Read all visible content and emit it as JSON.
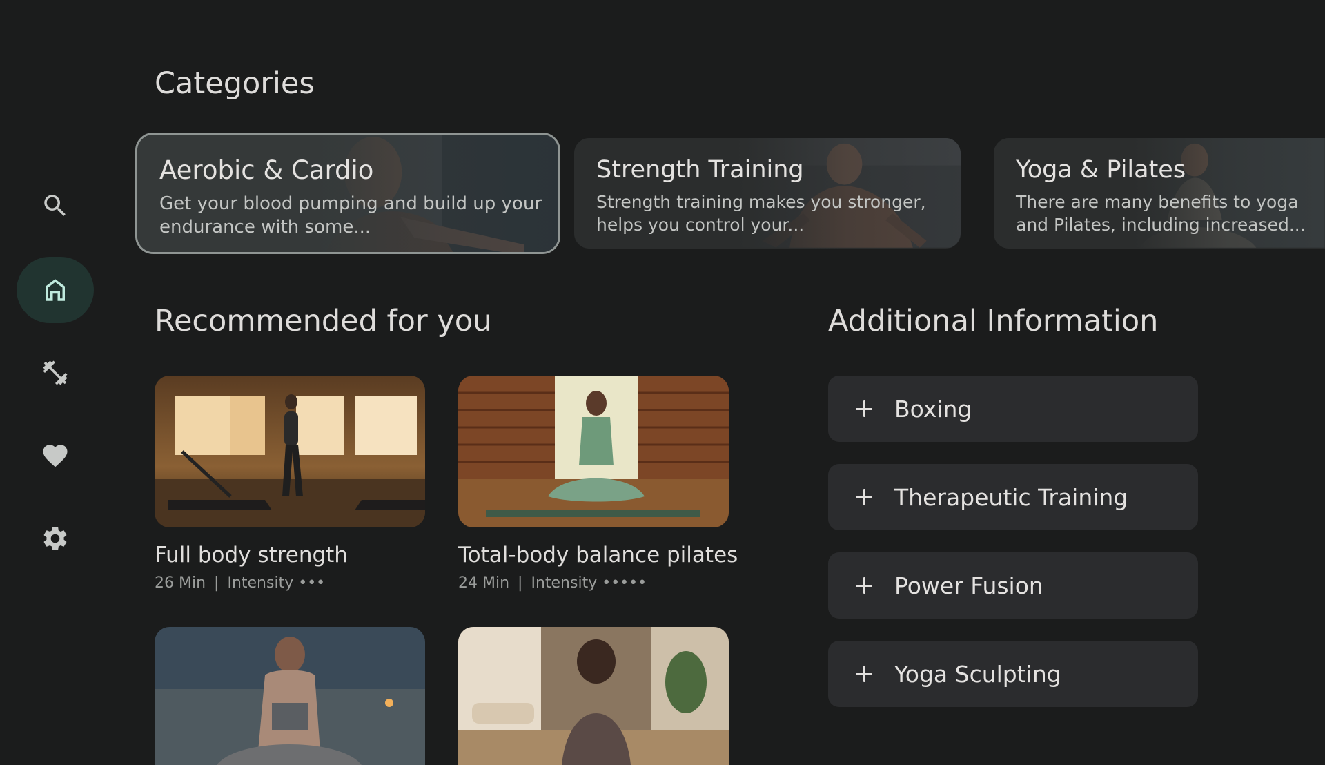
{
  "nav": {
    "items": [
      {
        "icon": "search-icon",
        "active": false
      },
      {
        "icon": "home-icon",
        "active": true
      },
      {
        "icon": "dumbbell-icon",
        "active": false
      },
      {
        "icon": "heart-icon",
        "active": false
      },
      {
        "icon": "gear-icon",
        "active": false
      }
    ]
  },
  "categories": {
    "title": "Categories",
    "items": [
      {
        "name": "Aerobic & Cardio",
        "description": "Get your blood pumping and build up your endurance with some...",
        "focused": true
      },
      {
        "name": "Strength Training",
        "description": "Strength training makes you stronger, helps you control your...",
        "focused": false
      },
      {
        "name": "Yoga & Pilates",
        "description": "There are many benefits to yoga and Pilates, including increased...",
        "focused": false
      }
    ]
  },
  "recommended": {
    "title": "Recommended for you",
    "items": [
      {
        "title": "Full body strength",
        "duration": "26 Min",
        "intensity_label": "Intensity",
        "intensity_dots": "•••"
      },
      {
        "title": "Total-body balance pilates",
        "duration": "24 Min",
        "intensity_label": "Intensity",
        "intensity_dots": "•••••"
      },
      {
        "title": "",
        "duration": "",
        "intensity_label": "",
        "intensity_dots": ""
      },
      {
        "title": "",
        "duration": "",
        "intensity_label": "",
        "intensity_dots": ""
      }
    ]
  },
  "additional": {
    "title": "Additional Information",
    "items": [
      {
        "label": "Boxing",
        "icon": "plus-icon"
      },
      {
        "label": "Therapeutic Training",
        "icon": "plus-icon"
      },
      {
        "label": "Power Fusion",
        "icon": "plus-icon"
      },
      {
        "label": "Yoga Sculpting",
        "icon": "plus-icon"
      }
    ]
  },
  "colors": {
    "background": "#1b1c1c",
    "nav_active_bg": "#213430",
    "nav_active_fg": "#bfeadd",
    "card_bg": "#2a2c2c",
    "accordion_bg": "#2b2c2e",
    "secondary_text": "#9b9d9b"
  }
}
